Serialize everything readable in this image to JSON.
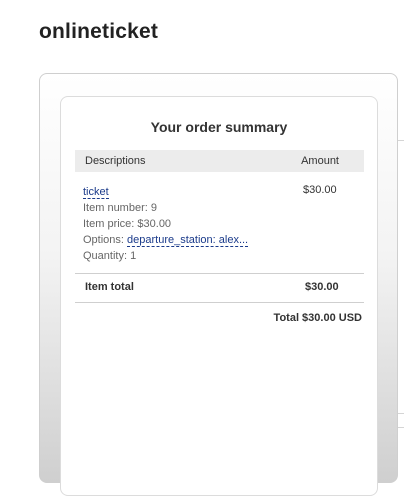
{
  "brand": "onlineticket",
  "summary": {
    "title": "Your order summary",
    "columns": {
      "description": "Descriptions",
      "amount": "Amount"
    },
    "item": {
      "name": "ticket",
      "number_label": "Item number: 9",
      "price_label": "Item price: $30.00",
      "options_prefix": "Options:",
      "options_value": "departure_station: alex...",
      "quantity_label": "Quantity: 1",
      "amount": "$30.00"
    },
    "item_total": {
      "label": "Item total",
      "value": "$30.00"
    },
    "grand_total": "Total $30.00 USD"
  }
}
